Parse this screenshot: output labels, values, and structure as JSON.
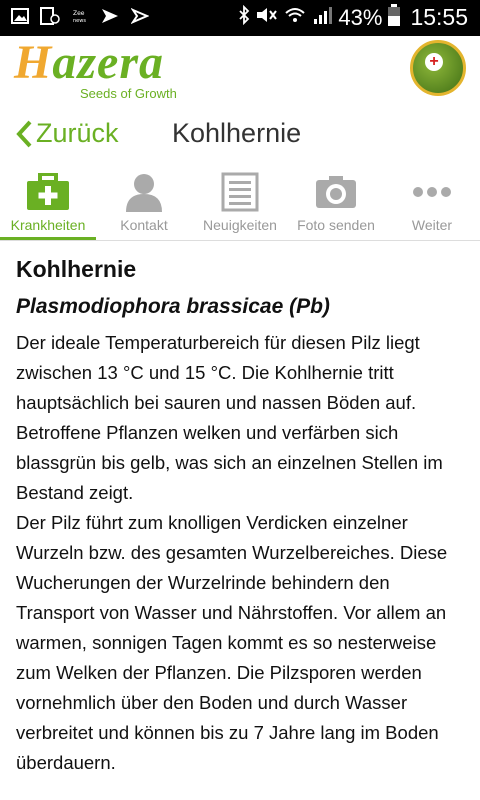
{
  "status_bar": {
    "battery_percent": "43%",
    "time": "15:55"
  },
  "header": {
    "logo_text": "Hazera",
    "tagline": "Seeds of Growth"
  },
  "titlebar": {
    "back_label": "Zurück",
    "title": "Kohlhernie"
  },
  "tabs": [
    {
      "label": "Krankheiten",
      "icon": "first-aid-kit-icon",
      "active": true
    },
    {
      "label": "Kontakt",
      "icon": "person-icon",
      "active": false
    },
    {
      "label": "Neuigkeiten",
      "icon": "newspaper-icon",
      "active": false
    },
    {
      "label": "Foto senden",
      "icon": "camera-icon",
      "active": false
    },
    {
      "label": "Weiter",
      "icon": "more-dots-icon",
      "active": false
    }
  ],
  "article": {
    "heading": "Kohlhernie",
    "scientific_name": "Plasmodiophora brassicae (Pb)",
    "paragraph1": "Der ideale Temperaturbereich für diesen Pilz liegt zwischen 13 °C und 15 °C. Die Kohlhernie tritt hauptsächlich bei sauren und nassen Böden auf. Betroffene Pflanzen welken und verfärben sich blassgrün bis gelb, was sich an einzelnen Stellen im Bestand zeigt.",
    "paragraph2": "Der Pilz führt zum knolligen Verdicken einzelner Wurzeln bzw. des gesamten Wurzelbereiches. Diese Wucherungen der Wurzelrinde behindern den Transport von Wasser und Nährstoffen. Vor allem an warmen, sonnigen Tagen kommt es so nesterweise zum Welken der Pflanzen. Die Pilzsporen werden vornehmlich über den Boden und durch Wasser verbreitet und können bis zu 7 Jahre lang im Boden überdauern."
  },
  "colors": {
    "accent_green": "#6ab023",
    "logo_orange": "#f0a830",
    "inactive_gray": "#999999"
  }
}
